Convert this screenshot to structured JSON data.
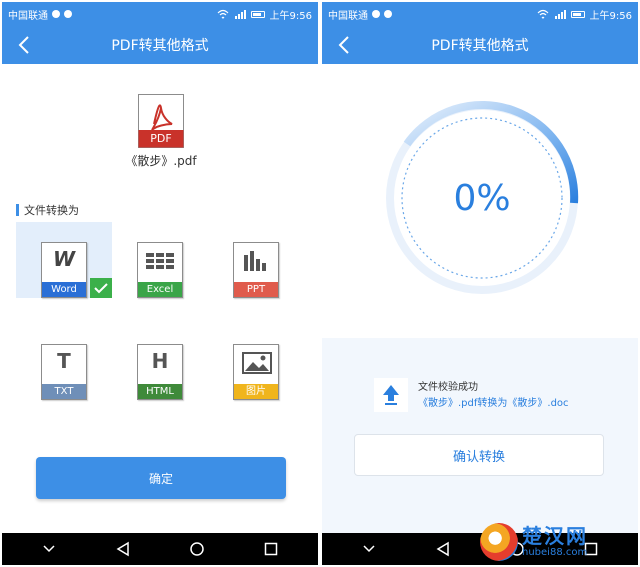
{
  "status_bar": {
    "carrier": "中国联通",
    "time": "上午9:56",
    "carrier_suffix": "4G"
  },
  "header": {
    "title": "PDF转其他格式"
  },
  "left": {
    "file": {
      "icon_label": "PDF",
      "name": "《散步》.pdf"
    },
    "section_label": "文件转换为",
    "options": [
      {
        "label": "Word",
        "glyph": "W",
        "color": "#2a6fd6"
      },
      {
        "label": "Excel",
        "glyph": "▦",
        "color": "#3aa548"
      },
      {
        "label": "PPT",
        "glyph": "▮",
        "color": "#e05b4c"
      },
      {
        "label": "TXT",
        "glyph": "T",
        "color": "#6f8fb8"
      },
      {
        "label": "HTML",
        "glyph": "H",
        "color": "#3f8a3a"
      },
      {
        "label": "图片",
        "glyph": "▣",
        "color": "#f0b51c"
      }
    ],
    "selected_option": "Word",
    "confirm_button": "确定"
  },
  "right": {
    "progress_percent": 0,
    "progress_label": "0%",
    "verify_text": "文件校验成功",
    "convert_text": "《散步》.pdf转换为《散步》.doc",
    "confirm_button": "确认转换"
  },
  "watermark": {
    "main": "楚汉网",
    "sub": "hubei88.com"
  },
  "colors": {
    "accent": "#3d8fe6",
    "selected_bg": "#e3eefb",
    "success": "#3bb04a"
  },
  "icons": [
    "back-arrow-icon",
    "pdf-file-icon",
    "check-icon",
    "upload-arrow-icon",
    "nav-back-icon",
    "nav-home-icon",
    "nav-recent-icon",
    "nav-down-icon",
    "wifi-icon",
    "signal-icon",
    "battery-icon"
  ]
}
